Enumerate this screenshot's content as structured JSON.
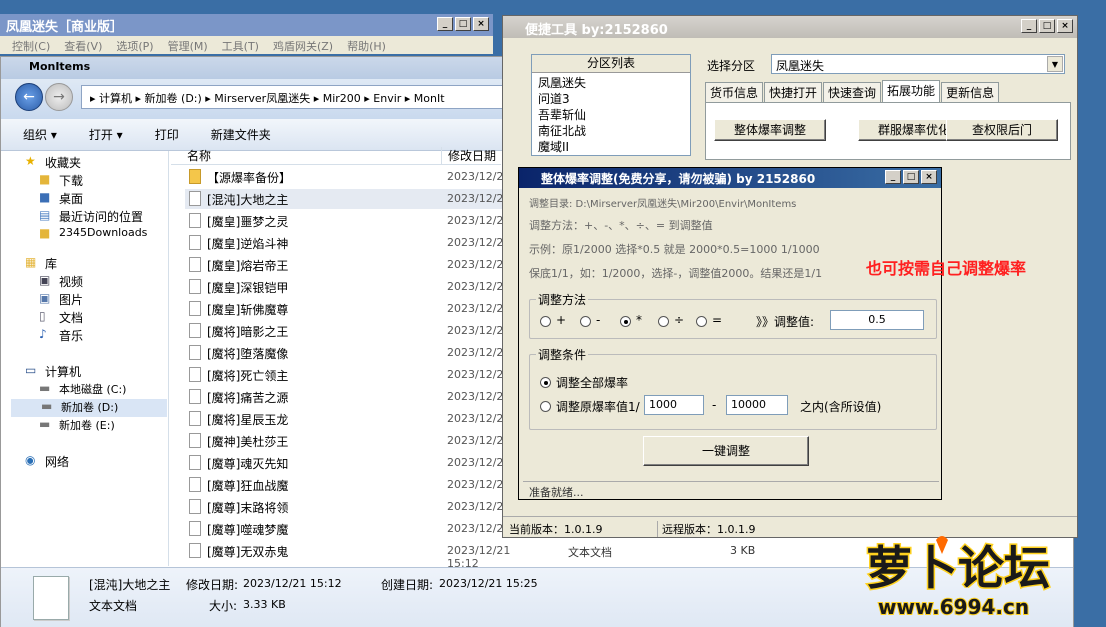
{
  "game_window": {
    "title": "凤凰迷失［商业版］",
    "menu": [
      "控制(C)",
      "查看(V)",
      "选项(P)",
      "管理(M)",
      "工具(T)",
      "鸡盾网关(Z)",
      "帮助(H)"
    ]
  },
  "explorer": {
    "title": "MonItems",
    "address": "▸ 计算机 ▸ 新加卷 (D:) ▸ Mirserver凤凰迷失 ▸ Mir200 ▸ Envir ▸ MonIt",
    "commands": [
      "组织 ▾",
      "打开 ▾",
      "打印",
      "新建文件夹"
    ],
    "nav": [
      "收藏夹",
      "下载",
      "桌面",
      "最近访问的位置",
      "2345Downloads",
      "库",
      "视频",
      "图片",
      "文档",
      "音乐",
      "计算机",
      "本地磁盘 (C:)",
      "新加卷 (D:)",
      "新加卷 (E:)",
      "网络"
    ],
    "columns": {
      "name": "名称",
      "date": "修改日期"
    },
    "files": [
      {
        "name": "【源爆率备份】",
        "date": "2023/12/2"
      },
      {
        "name": "[混沌]大地之主",
        "date": "2023/12/2"
      },
      {
        "name": "[魔皇]噩梦之灵",
        "date": "2023/12/2"
      },
      {
        "name": "[魔皇]逆焰斗神",
        "date": "2023/12/2"
      },
      {
        "name": "[魔皇]熔岩帝王",
        "date": "2023/12/2"
      },
      {
        "name": "[魔皇]深银铠甲",
        "date": "2023/12/2"
      },
      {
        "name": "[魔皇]斩佛魔尊",
        "date": "2023/12/2"
      },
      {
        "name": "[魔将]暗影之王",
        "date": "2023/12/2"
      },
      {
        "name": "[魔将]堕落魔像",
        "date": "2023/12/2"
      },
      {
        "name": "[魔将]死亡领主",
        "date": "2023/12/2"
      },
      {
        "name": "[魔将]痛苦之源",
        "date": "2023/12/2"
      },
      {
        "name": "[魔将]星辰玉龙",
        "date": "2023/12/2"
      },
      {
        "name": "[魔神]美杜莎王",
        "date": "2023/12/2"
      },
      {
        "name": "[魔尊]魂灭先知",
        "date": "2023/12/2"
      },
      {
        "name": "[魔尊]狂血战魔",
        "date": "2023/12/2"
      },
      {
        "name": "[魔尊]末路将领",
        "date": "2023/12/2"
      },
      {
        "name": "[魔尊]噬魂梦魔",
        "date": "2023/12/2"
      },
      {
        "name": "[魔尊]无双赤鬼",
        "date": "2023/12/21 15:12"
      }
    ],
    "last_row": {
      "type": "文本文档",
      "size": "3 KB"
    },
    "details": {
      "name": "[混沌]大地之主",
      "mod_label": "修改日期:",
      "mod_date": "2023/12/21 15:12",
      "created_label": "创建日期:",
      "created_date": "2023/12/21 15:25",
      "type": "文本文档",
      "size_label": "大小:",
      "size": "3.33 KB"
    }
  },
  "tool": {
    "title": "便捷工具   by:2152860",
    "list_header": "分区列表",
    "zones": [
      "凤凰迷失",
      "问道3",
      "吾辈斩仙",
      "南征北战",
      "魔域II"
    ],
    "select_label": "选择分区",
    "selected": "凤凰迷失",
    "tabs": [
      "货币信息",
      "快捷打开",
      "快速查询",
      "拓展功能",
      "更新信息"
    ],
    "buttons": [
      "整体爆率调整",
      "群服爆率优化",
      "查权限后门"
    ],
    "current_version": "当前版本：1.0.1.9",
    "remote_version": "远程版本：1.0.1.9"
  },
  "dialog": {
    "title": "整体爆率调整(免费分享，请勿被骗)    by 2152860",
    "dir": "调整目录: D:\\Mirserver凤凰迷失\\Mir200\\Envir\\MonItems",
    "method": "调整方法：+、-、*、÷、=   到调整值",
    "example": "示例：原1/2000 选择*0.5 就是 2000*0.5=1000  1/1000",
    "floor": "保底1/1，如：1/2000，选择-，调整值2000。结果还是1/1",
    "method_group": "调整方法",
    "ops": [
      "+",
      "-",
      "*",
      "÷",
      "="
    ],
    "value_label": "》》调整值:",
    "value": "0.5",
    "cond_group": "调整条件",
    "cond_all": "调整全部爆率",
    "cond_range": "调整原爆率值1/",
    "range_from": "1000",
    "range_to": "10000",
    "range_dash": "-",
    "range_suffix": "之内(含所设值)",
    "action": "一键调整",
    "status": "准备就绪..."
  },
  "annotation": "也可按需自己调整爆率",
  "watermark": {
    "brand": "萝卜论坛",
    "url": "www.6994.cn"
  }
}
